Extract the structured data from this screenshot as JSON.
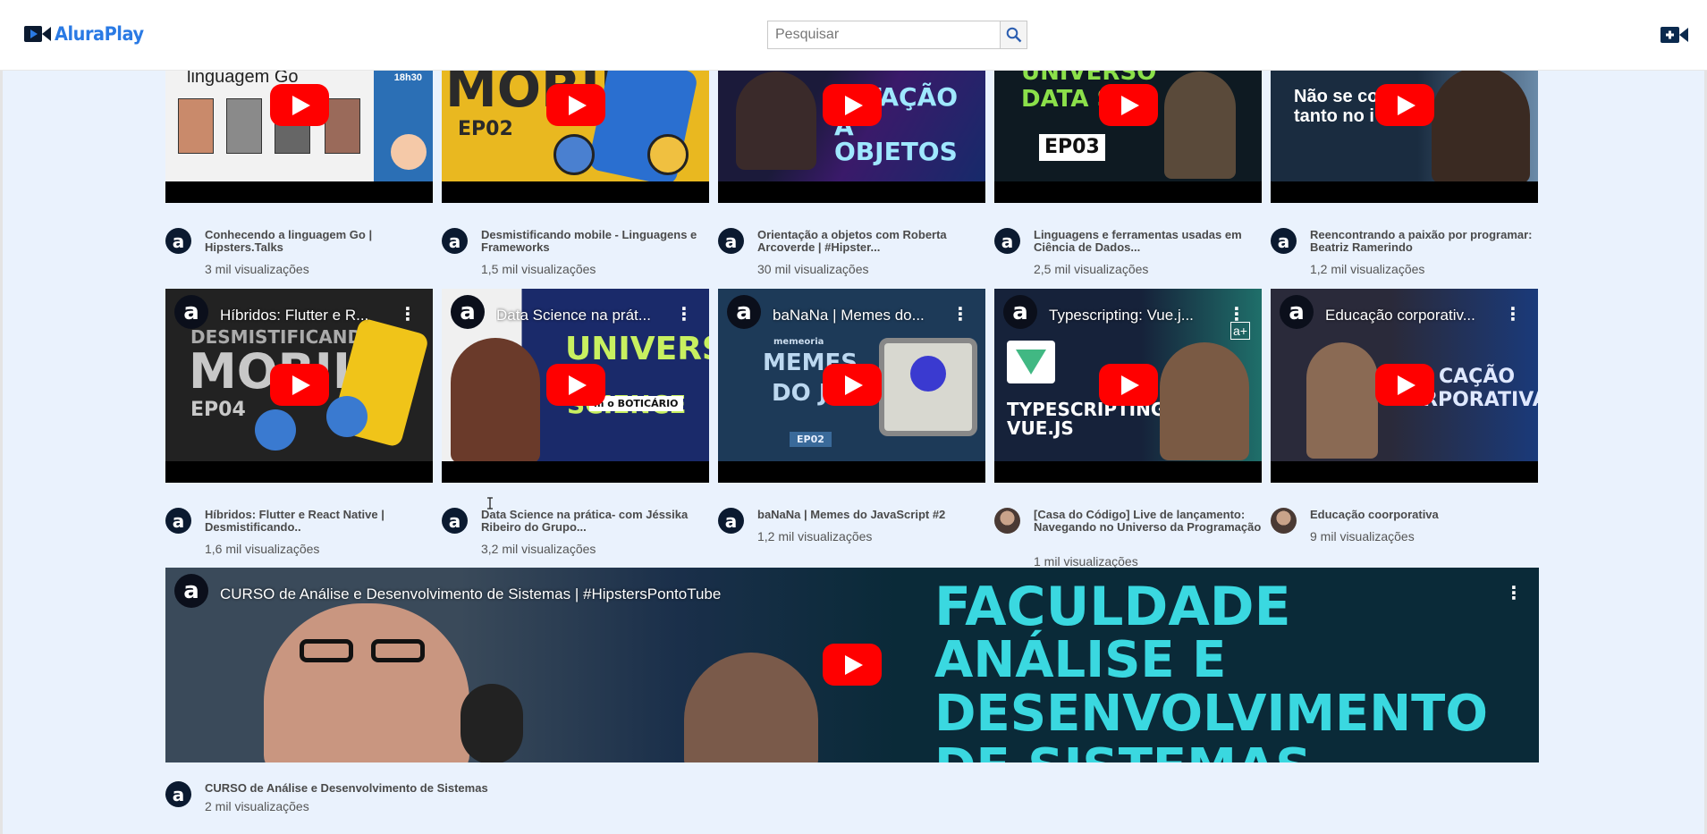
{
  "header": {
    "logo_text": "AluraPlay",
    "search_placeholder": "Pesquisar",
    "icons": {
      "logo": "video-camera-logo-icon",
      "search": "search-icon",
      "upload": "add-video-icon"
    }
  },
  "colors": {
    "brand": "#2a7ae4",
    "background": "#eaf2fd",
    "play": "#ff0000",
    "dark_navy": "#0b1a30"
  },
  "row1": [
    {
      "thumb_text": "linguagem Go",
      "badge": "18h30",
      "title": "Conhecendo a linguagem Go | Hipsters.Talks",
      "views": "3 mil visualizações"
    },
    {
      "thumb_text": "MOBILE",
      "thumb_sub": "EP02",
      "title": "Desmistificando mobile - Linguagens e Frameworks",
      "views": "1,5 mil visualizações"
    },
    {
      "thumb_text": "NTAÇÃO",
      "thumb_sub": "A OBJETOS",
      "title": "Orientação a objetos com Roberta Arcoverde | #Hipster...",
      "views": "30 mil visualizações"
    },
    {
      "thumb_text": "UNIVERSO",
      "thumb_sub": "DATA SC",
      "thumb_ep": "EP03",
      "title": "Linguagens e ferramentas usadas em Ciência de Dados...",
      "views": "2,5 mil visualizações"
    },
    {
      "thumb_text": "Não se co",
      "thumb_sub": "tanto no i",
      "title": "Reencontrando a paixão por programar: Beatriz Ramerindo",
      "views": "1,2 mil visualizações"
    }
  ],
  "row2": [
    {
      "overlay": "Híbridos: Flutter e R...",
      "thumb_text": "MOBILE",
      "thumb_top": "DESMISTIFICANDO",
      "thumb_sub": "EP04",
      "title": "Híbridos: Flutter e React Native | Desmistificando..",
      "views": "1,6 mil visualizações"
    },
    {
      "overlay": "Data Science na prát...",
      "thumb_text": "UNIVERSO",
      "thumb_sub": "A SCIENCE",
      "thumb_ep": "m o BOTICÁRIO",
      "title": "Data Science na prática- com Jéssika Ribeiro do Grupo...",
      "views": "3,2 mil visualizações"
    },
    {
      "overlay": "baNaNa | Memes do...",
      "thumb_top": "memeoria",
      "thumb_text": "MEMES",
      "thumb_sub": "DO JS",
      "thumb_ep": "EP02",
      "title": "baNaNa | Memes do JavaScript #2",
      "views": "1,2 mil visualizações"
    },
    {
      "overlay": "Typescripting: Vue.j...",
      "thumb_text": "TYPESCRIPTING:",
      "thumb_sub": "VUE.JS",
      "thumb_ep": "a+",
      "title": "[Casa do Código] Live de lançamento: Navegando no Universo da Programação",
      "views": "1 mil visualizações"
    },
    {
      "overlay": "Educação corporativ...",
      "thumb_text": "CAÇÃO",
      "thumb_sub": "RPORATIVA",
      "title": "Educação coorporativa",
      "views": "9 mil visualizações"
    }
  ],
  "wide": {
    "overlay": "CURSO de Análise e Desenvolvimento de Sistemas | #HipstersPontoTube",
    "line1": "FACULDADE",
    "line2": "ANÁLISE E",
    "line3": "DESENVOLVIMENTO",
    "line4": "DE SISTEMAS",
    "title": "CURSO de Análise e Desenvolvimento de Sistemas",
    "views": "2 mil visualizações"
  },
  "channel_glyph": "a",
  "kebab_glyph": "⋮"
}
